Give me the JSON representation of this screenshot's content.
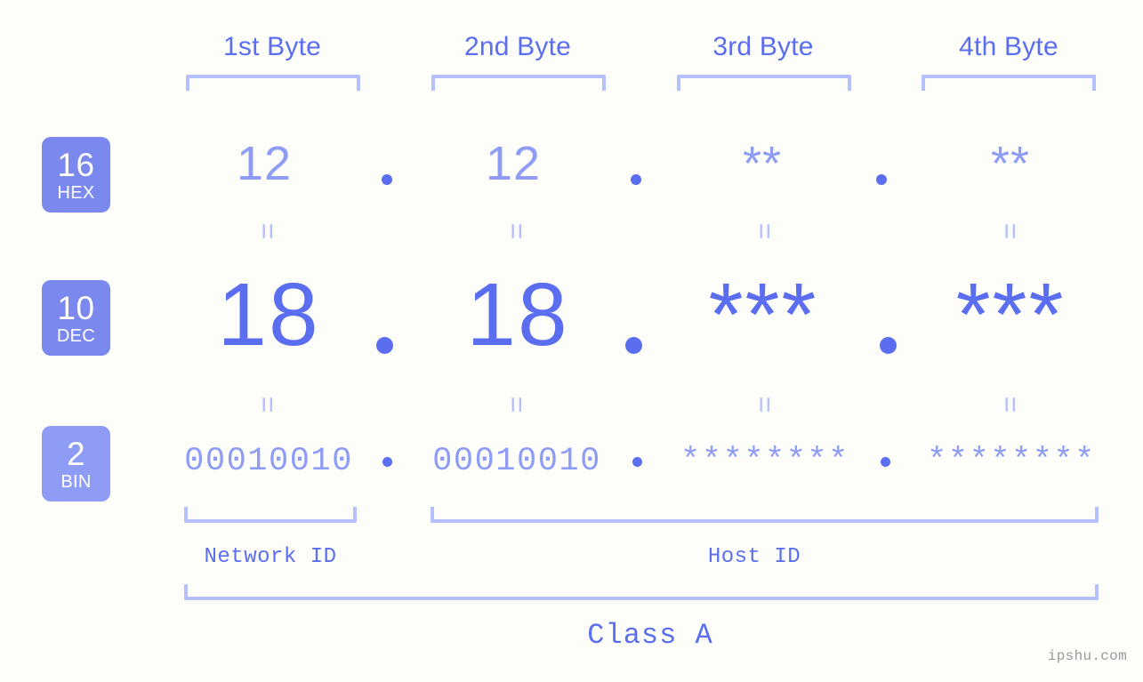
{
  "background_color": "#fdfefa",
  "colors": {
    "accent_strong": "#5b6ef0",
    "accent_mid": "#8e9cf6",
    "accent_light": "#b5bffb",
    "badge_hex": "#7b89ef",
    "badge_dec": "#7b89ef",
    "badge_bin": "#8e9cf6",
    "watermark": "#9a9a9a"
  },
  "byte_headers": [
    {
      "label": "1st Byte"
    },
    {
      "label": "2nd Byte"
    },
    {
      "label": "3rd Byte"
    },
    {
      "label": "4th Byte"
    }
  ],
  "radix_badges": [
    {
      "number": "16",
      "name": "HEX"
    },
    {
      "number": "10",
      "name": "DEC"
    },
    {
      "number": "2",
      "name": "BIN"
    }
  ],
  "rows": {
    "hex": {
      "radix": "16",
      "radix_name": "HEX",
      "values": [
        "12",
        "12",
        "**",
        "**"
      ],
      "separator": "."
    },
    "dec": {
      "radix": "10",
      "radix_name": "DEC",
      "values": [
        "18",
        "18",
        "***",
        "***"
      ],
      "separator": "."
    },
    "bin": {
      "radix": "2",
      "radix_name": "BIN",
      "values": [
        "00010010",
        "00010010",
        "********",
        "********"
      ],
      "separator": "."
    }
  },
  "equals_symbol": "=",
  "regions": [
    {
      "label": "Network ID"
    },
    {
      "label": "Host ID"
    }
  ],
  "class_label": "Class A",
  "watermark": "ipshu.com"
}
